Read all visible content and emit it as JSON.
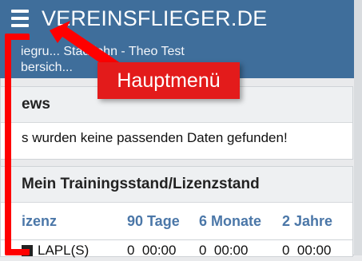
{
  "app": {
    "brand": "VEREINSFLIEGER.DE",
    "subtitle": "iegru... Stadtlohn - Theo Test",
    "subtitle2": "bersich..."
  },
  "news": {
    "title": "ews",
    "message": "s wurden keine passenden Daten gefunden!"
  },
  "training": {
    "title": "Mein Trainingsstand/Lizenzstand",
    "columns": [
      "izenz",
      "90 Tage",
      "6 Monate",
      "2 Jahre"
    ],
    "rows": [
      {
        "name": "LAPL(S)",
        "c90": "0",
        "t90": "00:00",
        "c6": "0",
        "t6": "00:00",
        "c2": "0",
        "t2": "00:00"
      }
    ]
  },
  "annotation": {
    "callout": "Hauptmenü"
  },
  "colors": {
    "header": "#3f6e9b",
    "accent_text": "#4b77a8",
    "annotation": "#ff0000"
  }
}
